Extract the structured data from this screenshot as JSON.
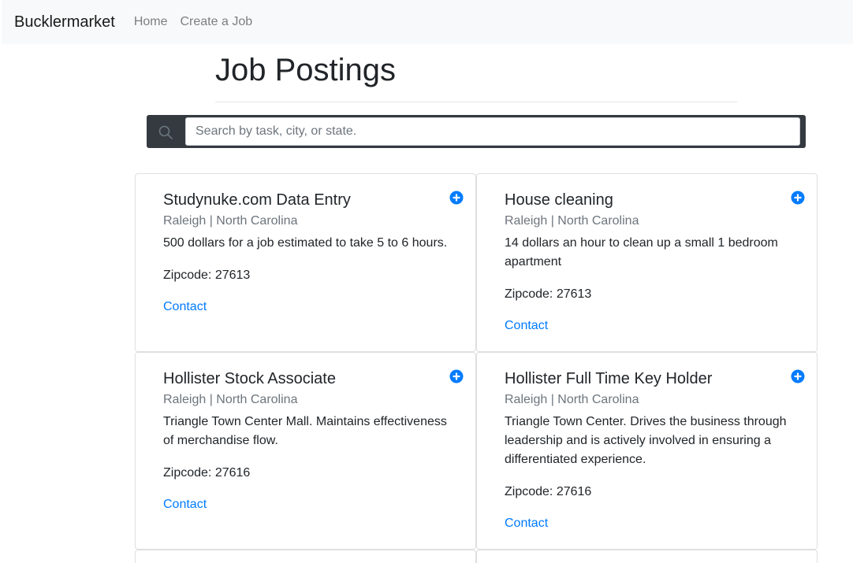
{
  "navbar": {
    "brand": "Bucklermarket",
    "links": [
      "Home",
      "Create a Job"
    ]
  },
  "page": {
    "title": "Job Postings"
  },
  "search": {
    "placeholder": "Search by task, city, or state."
  },
  "zip_label": "Zipcode:",
  "jobs": [
    {
      "title": "Studynuke.com Data Entry",
      "location": "Raleigh | North Carolina",
      "description": "500 dollars for a job estimated to take 5 to 6 hours.",
      "zipcode": "27613",
      "contact": "Contact"
    },
    {
      "title": "House cleaning",
      "location": "Raleigh | North Carolina",
      "description": "14 dollars an hour to clean up a small 1 bedroom apartment",
      "zipcode": "27613",
      "contact": "Contact"
    },
    {
      "title": "Hollister Stock Associate",
      "location": "Raleigh | North Carolina",
      "description": "Triangle Town Center Mall. Maintains effectiveness of merchandise flow.",
      "zipcode": "27616",
      "contact": "Contact"
    },
    {
      "title": "Hollister Full Time Key Holder",
      "location": "Raleigh | North Carolina",
      "description": "Triangle Town Center. Drives the business through leadership and is actively involved in ensuring a differentiated experience.",
      "zipcode": "27616",
      "contact": "Contact"
    }
  ],
  "colors": {
    "navbar_bg": "#f8f9fa",
    "search_bar_bg": "#343a40",
    "link": "#007bff",
    "icon_accent": "#007bff"
  },
  "icons": {
    "search": "search-icon",
    "add": "plus-circle-icon"
  }
}
